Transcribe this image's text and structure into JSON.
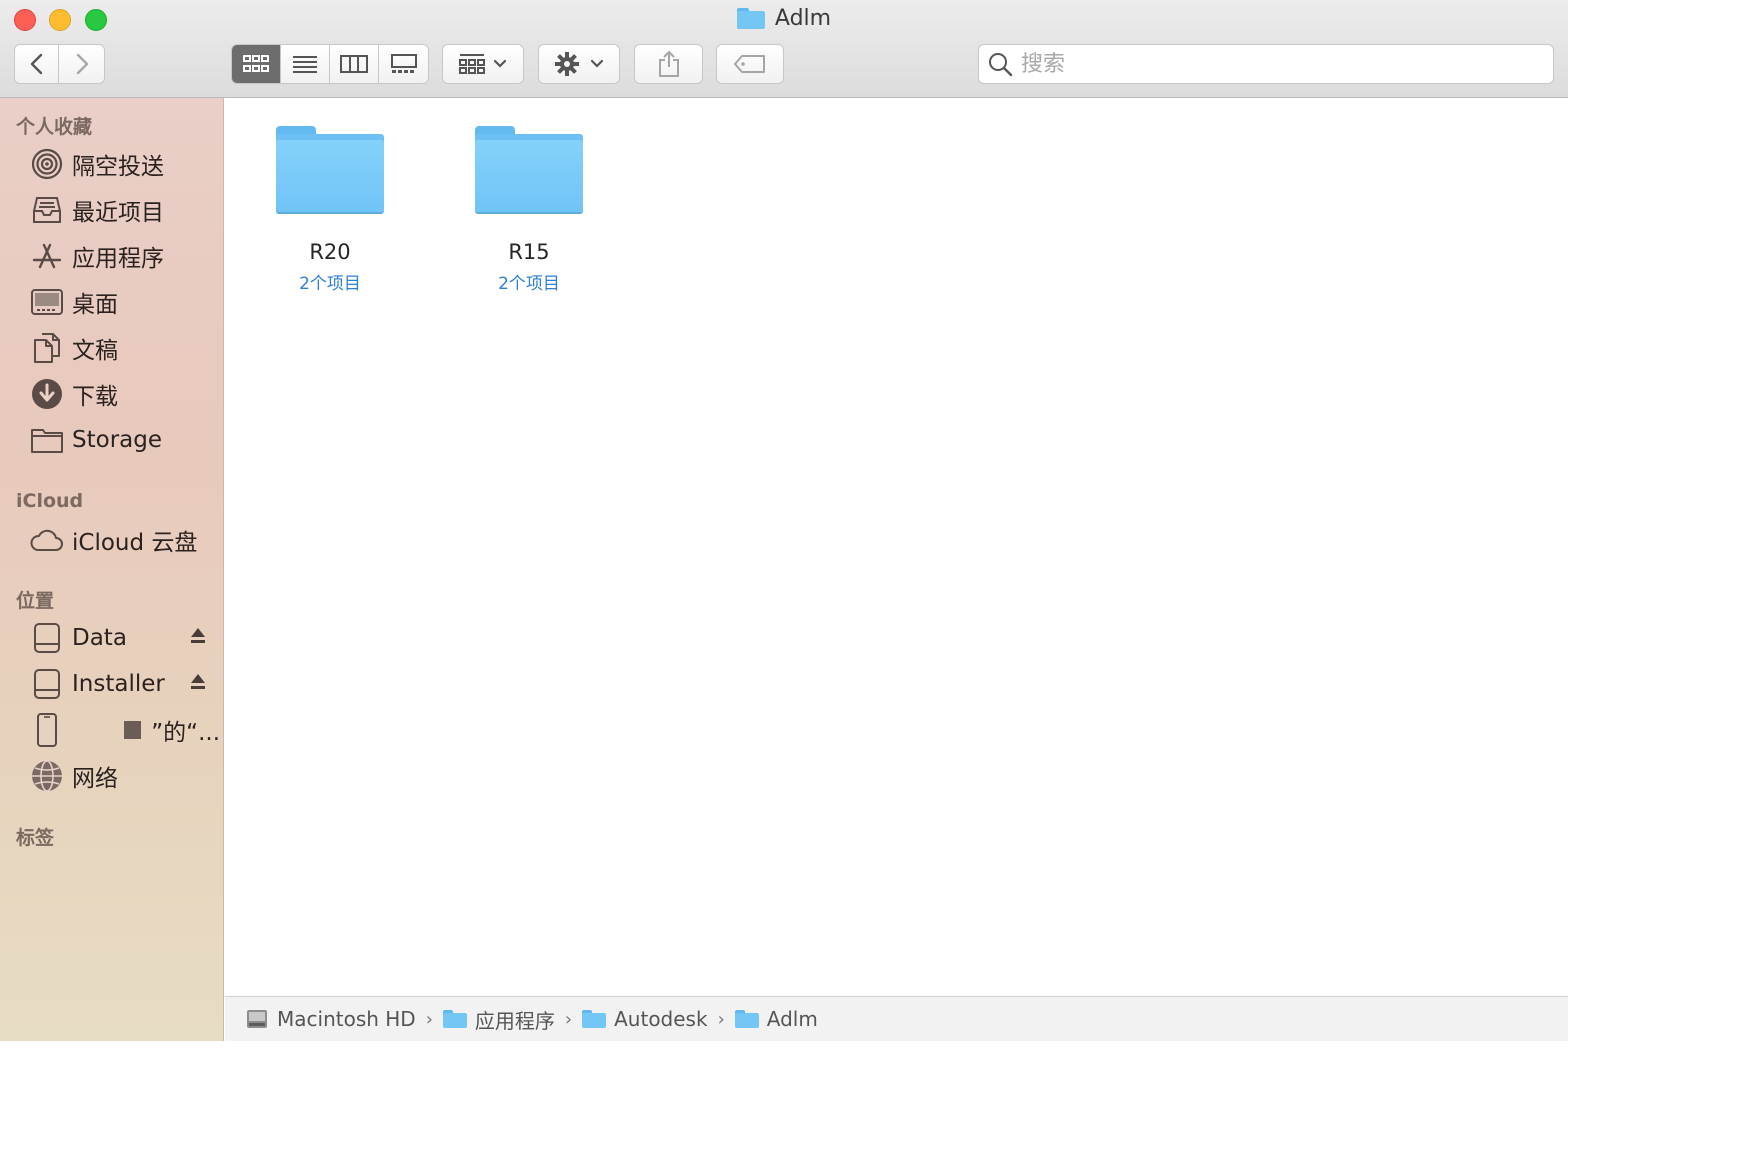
{
  "window": {
    "title": "Adlm"
  },
  "search": {
    "placeholder": "搜索",
    "value": ""
  },
  "sidebar": {
    "favorites_header": "个人收藏",
    "favorites": [
      {
        "label": "隔空投送",
        "icon": "airdrop-icon"
      },
      {
        "label": "最近项目",
        "icon": "recents-icon"
      },
      {
        "label": "应用程序",
        "icon": "applications-icon"
      },
      {
        "label": "桌面",
        "icon": "desktop-icon"
      },
      {
        "label": "文稿",
        "icon": "documents-icon"
      },
      {
        "label": "下载",
        "icon": "downloads-icon"
      },
      {
        "label": "Storage",
        "icon": "folder-icon"
      }
    ],
    "icloud_header": "iCloud",
    "icloud": [
      {
        "label": "iCloud 云盘",
        "icon": "cloud-icon"
      }
    ],
    "locations_header": "位置",
    "locations": [
      {
        "label": "Data",
        "icon": "drive-icon",
        "eject": true
      },
      {
        "label": "Installer",
        "icon": "drive-icon",
        "eject": true
      },
      {
        "label": "”的“...",
        "icon": "iphone-icon",
        "eject": false
      },
      {
        "label": "网络",
        "icon": "network-icon",
        "eject": false
      }
    ],
    "tags_header": "标签"
  },
  "files": [
    {
      "name": "R20",
      "subtitle": "2个项目"
    },
    {
      "name": "R15",
      "subtitle": "2个项目"
    }
  ],
  "pathbar": [
    {
      "label": "Macintosh HD",
      "icon": "hard-drive-icon"
    },
    {
      "label": "应用程序",
      "icon": "applications-folder-icon"
    },
    {
      "label": "Autodesk",
      "icon": "folder-icon"
    },
    {
      "label": "Adlm",
      "icon": "folder-icon"
    }
  ],
  "colors": {
    "accent": "#2f7fd6",
    "folder": "#74c6f5",
    "close": "#fd5f57",
    "minimize": "#febc2e",
    "maximize": "#28c840"
  }
}
